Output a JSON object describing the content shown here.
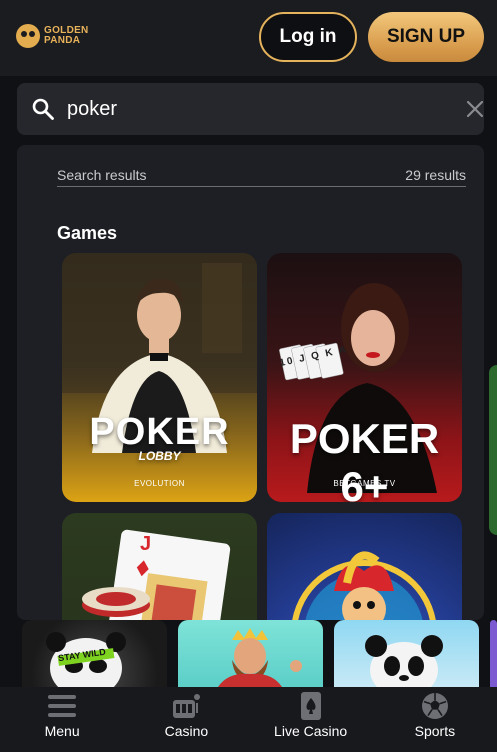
{
  "header": {
    "logo_line1": "GOLDEN",
    "logo_line2": "PANDA",
    "login_label": "Log in",
    "signup_label": "SIGN UP"
  },
  "search": {
    "value": "poker",
    "icon": "search-icon",
    "clear_icon": "close-icon"
  },
  "results": {
    "label": "Search results",
    "count": "29 results",
    "section_heading": "Games",
    "games": [
      {
        "title": "POKER",
        "subtitle": "LOBBY",
        "provider": "EVOLUTION"
      },
      {
        "title": "POKER 6+",
        "provider": "BETGAMES TV",
        "cards_text": "10 J Q K A"
      },
      {
        "card_letter": "J"
      },
      {}
    ]
  },
  "strip": {
    "tiles": [
      {
        "text": "STAY WILD"
      },
      {},
      {},
      {}
    ]
  },
  "bottom_nav": {
    "items": [
      {
        "label": "Menu",
        "icon": "menu-icon"
      },
      {
        "label": "Casino",
        "icon": "slot-machine-icon"
      },
      {
        "label": "Live Casino",
        "icon": "playing-card-icon"
      },
      {
        "label": "Sports",
        "icon": "soccer-ball-icon"
      }
    ]
  },
  "colors": {
    "accent_gold": "#e5b35c",
    "background": "#101114",
    "panel": "#1e1f24"
  }
}
